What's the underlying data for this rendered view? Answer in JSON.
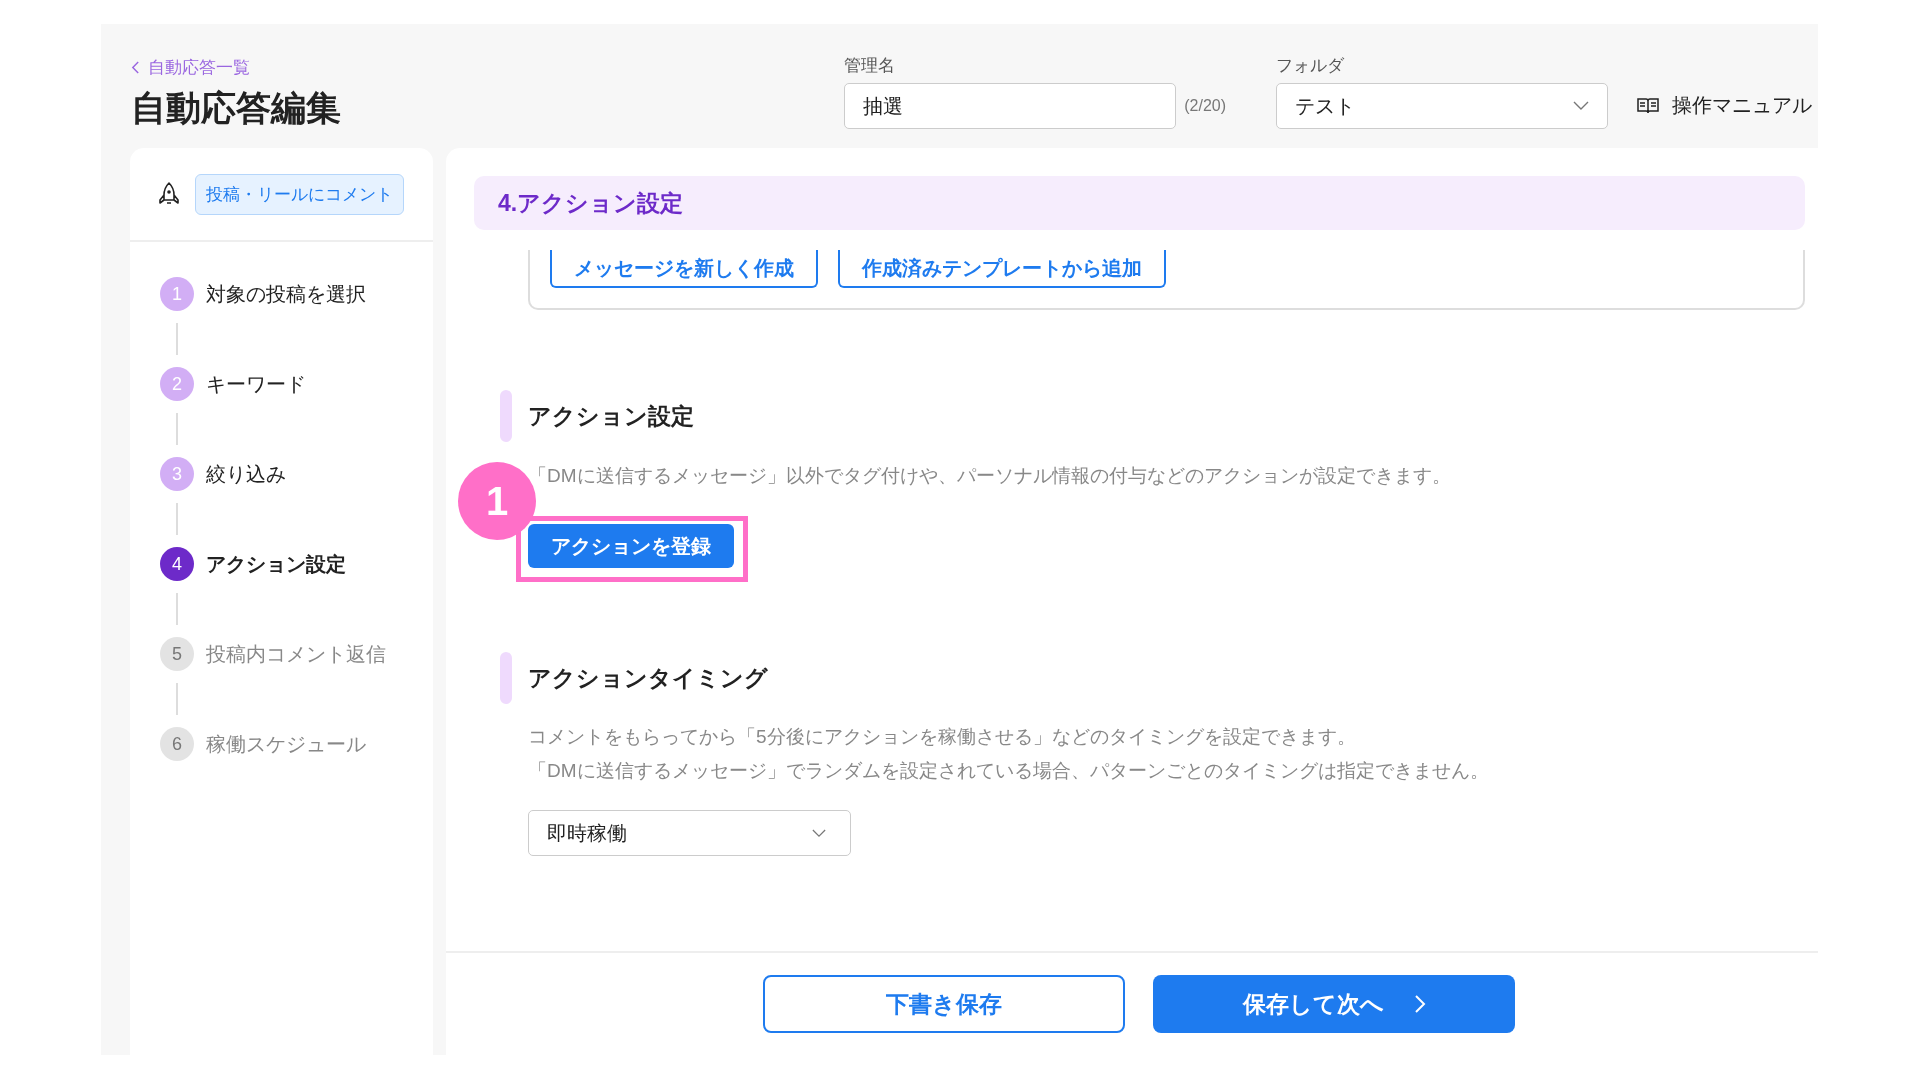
{
  "header": {
    "back_link": "自動応答一覧",
    "title": "自動応答編集",
    "name_field": {
      "label": "管理名",
      "value": "抽選",
      "counter": "(2/20)"
    },
    "folder_field": {
      "label": "フォルダ",
      "value": "テスト"
    },
    "manual_link": "操作マニュアル"
  },
  "sidebar": {
    "trigger_badge": "投稿・リールにコメント",
    "steps": [
      {
        "number": "1",
        "label": "対象の投稿を選択",
        "completed": true,
        "selected": false
      },
      {
        "number": "2",
        "label": "キーワード",
        "completed": true,
        "selected": false
      },
      {
        "number": "3",
        "label": "絞り込み",
        "completed": true,
        "selected": false
      },
      {
        "number": "4",
        "label": "アクション設定",
        "completed": false,
        "selected": true
      },
      {
        "number": "5",
        "label": "投稿内コメント返信",
        "completed": false,
        "selected": false
      },
      {
        "number": "6",
        "label": "稼働スケジュール",
        "completed": false,
        "selected": false
      }
    ]
  },
  "main": {
    "section_title": "4.アクション設定",
    "message_buttons": [
      "メッセージを新しく作成",
      "作成済みテンプレートから追加"
    ],
    "action_section": {
      "heading": "アクション設定",
      "description": "「DMに送信するメッセージ」以外でタグ付けや、パーソナル情報の付与などのアクションが設定できます。",
      "button": "アクションを登録",
      "annotation": "1"
    },
    "timing_section": {
      "heading": "アクションタイミング",
      "description_lines": [
        "コメントをもらってから「5分後にアクションを稼働させる」などのタイミングを設定できます。",
        "「DMに送信するメッセージ」でランダムを設定されている場合、パターンごとのタイミングは指定できません。"
      ],
      "select_value": "即時稼働"
    }
  },
  "footer": {
    "draft_button": "下書き保存",
    "next_button": "保存して次へ"
  }
}
